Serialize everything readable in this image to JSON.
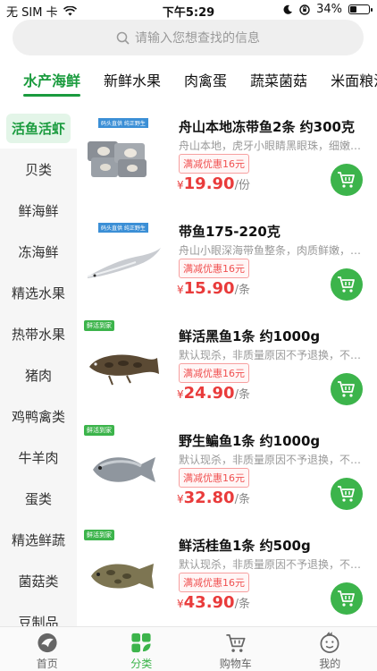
{
  "status": {
    "carrier": "无 SIM 卡",
    "time": "下午5:29",
    "battery": "34%",
    "battery_level": 0.34
  },
  "search": {
    "placeholder": "请输入您想查找的信息"
  },
  "tabs": [
    {
      "label": "水产海鲜",
      "active": true
    },
    {
      "label": "新鲜水果"
    },
    {
      "label": "肉禽蛋"
    },
    {
      "label": "蔬菜菌菇"
    },
    {
      "label": "米面粮油"
    }
  ],
  "sidebar": [
    {
      "label": "活鱼活虾",
      "active": true
    },
    {
      "label": "贝类"
    },
    {
      "label": "鲜海鲜"
    },
    {
      "label": "冻海鲜"
    },
    {
      "label": "精选水果"
    },
    {
      "label": "热带水果"
    },
    {
      "label": "猪肉"
    },
    {
      "label": "鸡鸭禽类"
    },
    {
      "label": "牛羊肉"
    },
    {
      "label": "蛋类"
    },
    {
      "label": "精选鲜蔬"
    },
    {
      "label": "菌菇类"
    },
    {
      "label": "豆制品"
    }
  ],
  "products": [
    {
      "title": "舟山本地冻带鱼2条 约300克",
      "desc": "舟山本地，虎牙小眼睛黑眼珠，细嫩润…",
      "promo": "满减优惠16元",
      "currency": "¥",
      "price": "19.90",
      "unit": "/份",
      "badge": "码头直供 纯正野生",
      "icon": "frozen-hairtail-fish"
    },
    {
      "title": "带鱼175-220克",
      "desc": "舟山小眼深海带鱼整条，肉质鲜嫩，味…",
      "promo": "满减优惠16元",
      "currency": "¥",
      "price": "15.90",
      "unit": "/条",
      "badge": "码头直供 纯正野生",
      "icon": "hairtail-fish"
    },
    {
      "title": "鲜活黑鱼1条 约1000g",
      "desc": "默认现杀，非质量原因不予退换，不可…",
      "promo": "满减优惠16元",
      "currency": "¥",
      "price": "24.90",
      "unit": "/条",
      "badge": "鲜活到家",
      "icon": "snakehead-fish"
    },
    {
      "title": "野生鳊鱼1条 约1000g",
      "desc": "默认现杀，非质量原因不予退换，不可…",
      "promo": "满减优惠16元",
      "currency": "¥",
      "price": "32.80",
      "unit": "/条",
      "badge": "鲜活到家",
      "icon": "bream-fish"
    },
    {
      "title": "鲜活桂鱼1条 约500g",
      "desc": "默认现杀，非质量原因不予退换，不可…",
      "promo": "满减优惠16元",
      "currency": "¥",
      "price": "43.90",
      "unit": "/条",
      "badge": "鲜活到家",
      "icon": "mandarin-fish"
    }
  ],
  "bottom_nav": [
    {
      "label": "首页",
      "icon": "home-icon"
    },
    {
      "label": "分类",
      "icon": "category-icon",
      "active": true
    },
    {
      "label": "购物车",
      "icon": "cart-icon"
    },
    {
      "label": "我的",
      "icon": "profile-icon"
    }
  ],
  "colors": {
    "accent": "#1a9b3e",
    "cart_button": "#3cb44b",
    "price": "#e93b3b"
  }
}
